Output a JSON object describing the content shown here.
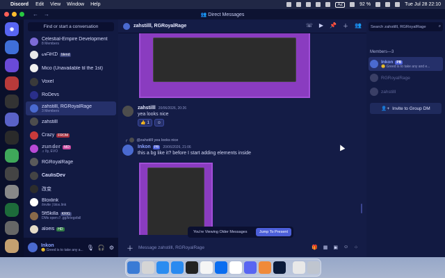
{
  "menubar": {
    "app_name": "Discord",
    "items": [
      "Edit",
      "View",
      "Window",
      "Help"
    ],
    "keyboard": "AZ",
    "battery": "92 %",
    "clock": "Tue Jul 28  22:10"
  },
  "window": {
    "title": "Direct Messages"
  },
  "dm_sidebar": {
    "finder_label": "Find or start a conversation",
    "items": [
      {
        "name": "Celestial-Empire Development",
        "sub": "8 Members",
        "avatar": "#7c6bd6"
      },
      {
        "name": "ᔕᗩᕼᗪ",
        "tag": "blend",
        "avatar": "#e8e8e8"
      },
      {
        "name": "Mico (Unavailable til the 1st)",
        "avatar": "#f0f0f0"
      },
      {
        "name": "Voxel",
        "avatar": "#3a3a3a"
      },
      {
        "name": "RoDevs",
        "avatar": "#2a2f8a"
      },
      {
        "name": "zahstilll, RGRoyalRage",
        "sub": "3 Members",
        "avatar": "#4a6ad0"
      },
      {
        "name": "zahstilll",
        "avatar": "#4d4d4d"
      },
      {
        "name": "Crazy",
        "tag": "FROM",
        "avatar": "#c93b3b"
      },
      {
        "name": "𝕫𝕦𝕟𝕕𝕖𝕣",
        "tag": "MD",
        "sub": "♫ Ily, EVO",
        "avatar": "#b94ad6"
      },
      {
        "name": "RGRoyalRage",
        "avatar": "#5a5a5a"
      },
      {
        "name": "CaulisDev",
        "avatar": "#444"
      },
      {
        "name": "改变",
        "avatar": "#2c2c2c"
      },
      {
        "name": "Bloxlink",
        "sub": "/invite | blox.link",
        "avatar": "#ffffff"
      },
      {
        "name": "5ft5killa",
        "tag": "KRIG",
        "sub": "DMs open // .gg/kriegsfall",
        "avatar": "#8a6a4a"
      },
      {
        "name": "aloeis",
        "tag": "HD",
        "avatar": "#e5dbc7"
      }
    ]
  },
  "user_panel": {
    "username": "Inkon",
    "status": "😊 Greed is to take any a..."
  },
  "chat": {
    "header_title": "zahstilll, RGRoyalRage",
    "messages": [
      {
        "author": "zahstilll",
        "time": "20/06/2026, 20:26",
        "text": "yea looks nice",
        "reaction_count": "1"
      },
      {
        "reply_to": "@zahstilll yea looks nice",
        "author": "Inkon",
        "tag": "PB",
        "time": "20/06/2026, 21:06",
        "text": "this a bg like it? before I start adding elements inside"
      }
    ],
    "older_notice": "You're Viewing Older Messages",
    "jump_label": "Jump To Present",
    "composer_placeholder": "Message zahstilll, RGRoyalRage"
  },
  "members": {
    "search_placeholder": "Search zahstilll, RGRoyalRage",
    "header": "Members—3",
    "list": [
      {
        "name": "Inkon",
        "tag": "PB",
        "status": "😊 Greed is to take any and e..."
      },
      {
        "name": "RGRoyalRage"
      },
      {
        "name": "zahstilll"
      }
    ],
    "add_button": "Invite to Group DM"
  },
  "colors": {
    "accent": "#5865f2",
    "chat_bg": "#141c46",
    "sidebar_bg": "#121a42",
    "image_frame": "#8a3cc0"
  }
}
